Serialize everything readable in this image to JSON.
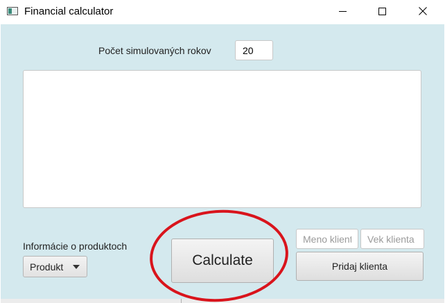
{
  "window": {
    "title": "Financial calculator"
  },
  "simulation": {
    "years_label": "Počet simulovaných rokov",
    "years_value": "20"
  },
  "output": {
    "text": ""
  },
  "products": {
    "info_label": "Informácie o produktoch",
    "dropdown_label": "Produkt"
  },
  "actions": {
    "calculate_label": "Calculate",
    "add_client_label": "Pridaj klienta"
  },
  "client_form": {
    "name_placeholder": "Meno klienta",
    "age_placeholder": "Vek klienta"
  },
  "colors": {
    "background": "#d4e9ee",
    "annotation": "#d9141c"
  }
}
